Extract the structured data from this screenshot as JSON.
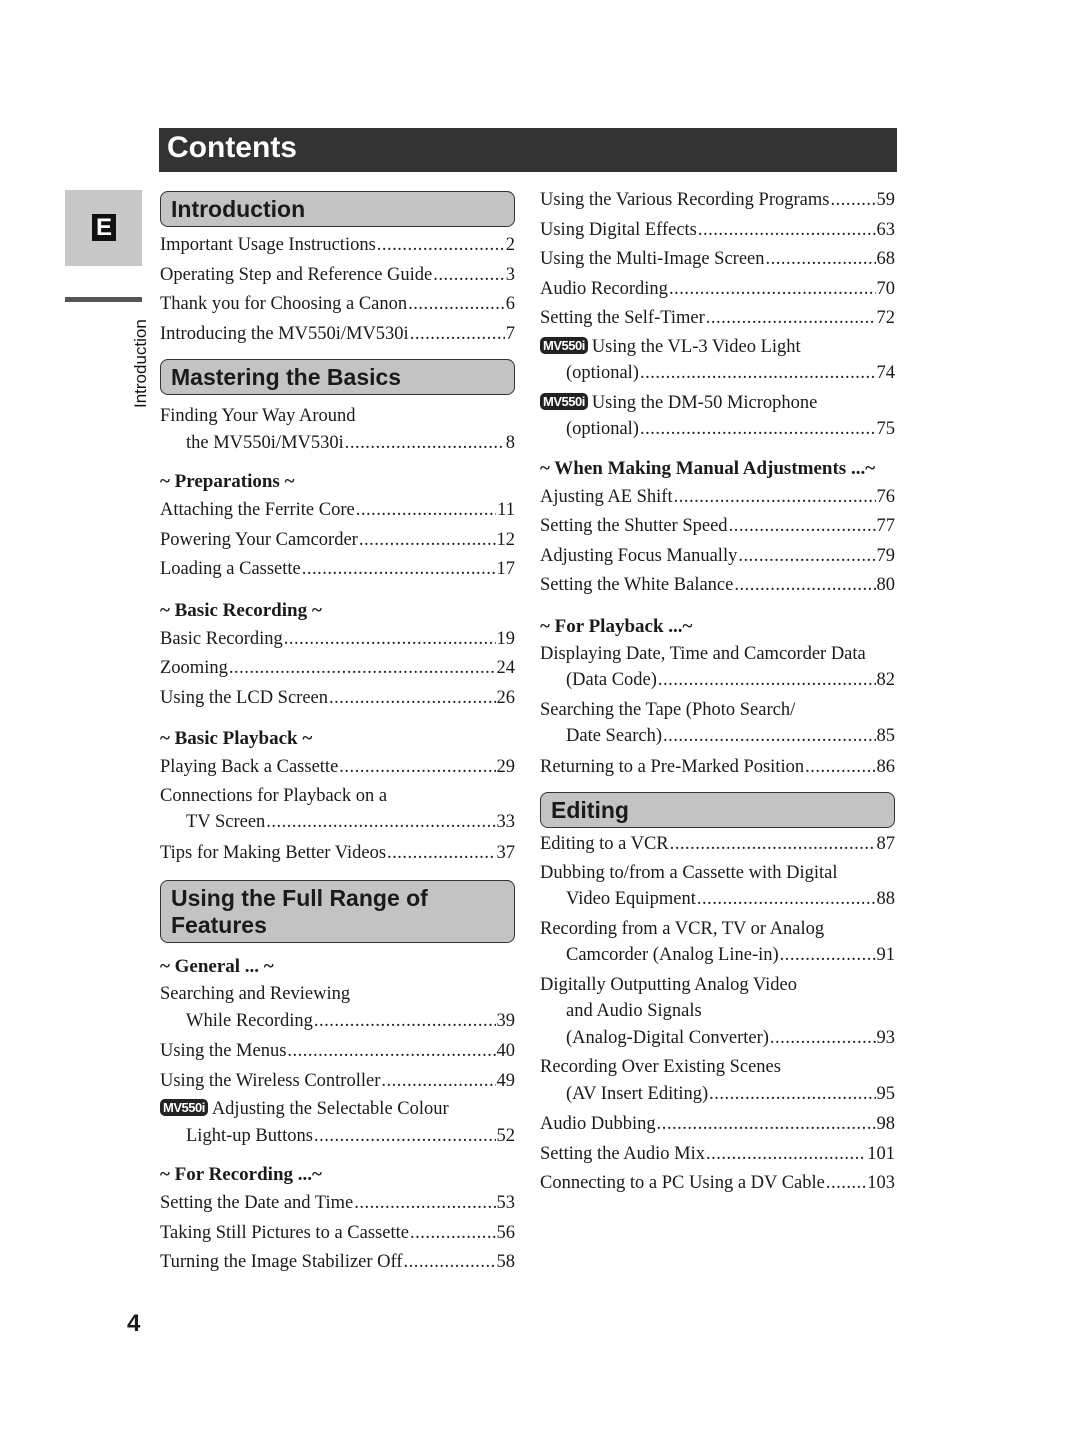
{
  "title": "Contents",
  "language_tab": "E",
  "side_label": "Introduction",
  "page_number": "4",
  "badge_label": "MV550i",
  "left": {
    "introduction": {
      "heading": "Introduction",
      "entries": [
        {
          "text": "Important Usage Instructions",
          "page": "2"
        },
        {
          "text": "Operating Step and Reference Guide",
          "page": "3"
        },
        {
          "text": "Thank you for Choosing a Canon",
          "page": "6"
        },
        {
          "text": "Introducing the MV550i/MV530i",
          "page": "7"
        }
      ]
    },
    "basics": {
      "heading": "Mastering the Basics",
      "finding": {
        "line1": "Finding Your Way Around",
        "line2": "the MV550i/MV530i",
        "page": "8"
      },
      "preparations": {
        "heading": "~ Preparations ~",
        "entries": [
          {
            "text": "Attaching the Ferrite Core",
            "page": "11"
          },
          {
            "text": "Powering Your Camcorder",
            "page": "12"
          },
          {
            "text": "Loading a Cassette",
            "page": "17"
          }
        ]
      },
      "basic_recording": {
        "heading": "~ Basic Recording ~",
        "entries": [
          {
            "text": "Basic Recording",
            "page": "19"
          },
          {
            "text": "Zooming",
            "page": "24"
          },
          {
            "text": "Using the LCD Screen",
            "page": "26"
          }
        ]
      },
      "basic_playback": {
        "heading": "~ Basic Playback ~",
        "entries": [
          {
            "text": "Playing Back a Cassette",
            "page": "29"
          }
        ],
        "connections": {
          "line1": "Connections for Playback on a",
          "line2": "TV Screen",
          "page": "33"
        },
        "tips": {
          "text": "Tips for Making Better Videos",
          "page": "37"
        }
      }
    },
    "full_range": {
      "heading_line1": "Using the Full Range of",
      "heading_line2": "Features",
      "general": {
        "heading": "~ General ... ~",
        "searching": {
          "line1": "Searching and Reviewing",
          "line2": "While Recording",
          "page": "39"
        },
        "entries": [
          {
            "text": "Using the Menus",
            "page": "40"
          },
          {
            "text": "Using the Wireless Controller",
            "page": "49"
          }
        ],
        "colour": {
          "line1": "Adjusting the Selectable Colour",
          "line2": "Light-up Buttons",
          "page": "52"
        }
      },
      "for_recording": {
        "heading": "~ For Recording ...~",
        "entries": [
          {
            "text": "Setting the Date and Time",
            "page": "53"
          },
          {
            "text": "Taking Still Pictures to a Cassette",
            "page": "56"
          },
          {
            "text": "Turning the Image Stabilizer Off",
            "page": "58"
          }
        ]
      }
    }
  },
  "right": {
    "top_entries": [
      {
        "text": "Using the Various Recording Programs",
        "page": "59"
      },
      {
        "text": "Using Digital Effects",
        "page": "63"
      },
      {
        "text": "Using the Multi-Image Screen",
        "page": "68"
      },
      {
        "text": "Audio Recording",
        "page": "70"
      },
      {
        "text": "Setting the Self-Timer",
        "page": "72"
      }
    ],
    "video_light": {
      "line1": "Using the VL-3 Video Light",
      "line2": "(optional)",
      "page": "74"
    },
    "microphone": {
      "line1": "Using the DM-50 Microphone",
      "line2": "(optional)",
      "page": "75"
    },
    "manual": {
      "heading": "~ When Making Manual Adjustments ...~",
      "entries": [
        {
          "text": "Ajusting AE Shift",
          "page": "76"
        },
        {
          "text": "Setting the Shutter Speed",
          "page": "77"
        },
        {
          "text": "Adjusting Focus Manually",
          "page": "79"
        },
        {
          "text": "Setting the White Balance",
          "page": "80"
        }
      ]
    },
    "playback": {
      "heading": "~ For Playback ...~",
      "data_code": {
        "line1": "Displaying Date, Time and Camcorder Data",
        "line2": "(Data Code)",
        "page": "82"
      },
      "photo_search": {
        "line1": "Searching the Tape (Photo Search/",
        "line2": "Date Search)",
        "page": "85"
      },
      "returning": {
        "text": "Returning to a Pre-Marked Position",
        "page": "86"
      }
    },
    "editing": {
      "heading": "Editing",
      "vcr": {
        "text": "Editing to a VCR",
        "page": "87"
      },
      "dubbing": {
        "line1": "Dubbing to/from a Cassette with Digital",
        "line2": "Video Equipment",
        "page": "88"
      },
      "recording_vcr": {
        "line1": "Recording from a VCR, TV or Analog",
        "line2": "Camcorder (Analog Line-in)",
        "page": "91"
      },
      "digital_out": {
        "line1": "Digitally Outputting Analog Video",
        "line2": "and Audio Signals",
        "line3": "(Analog-Digital Converter)",
        "page": "93"
      },
      "insert": {
        "line1": "Recording Over Existing Scenes",
        "line2": "(AV Insert Editing)",
        "page": "95"
      },
      "entries": [
        {
          "text": "Audio Dubbing",
          "page": "98"
        },
        {
          "text": "Setting the Audio Mix",
          "page": "101"
        },
        {
          "text": "Connecting to a PC Using a DV Cable",
          "page": "103"
        }
      ]
    }
  }
}
